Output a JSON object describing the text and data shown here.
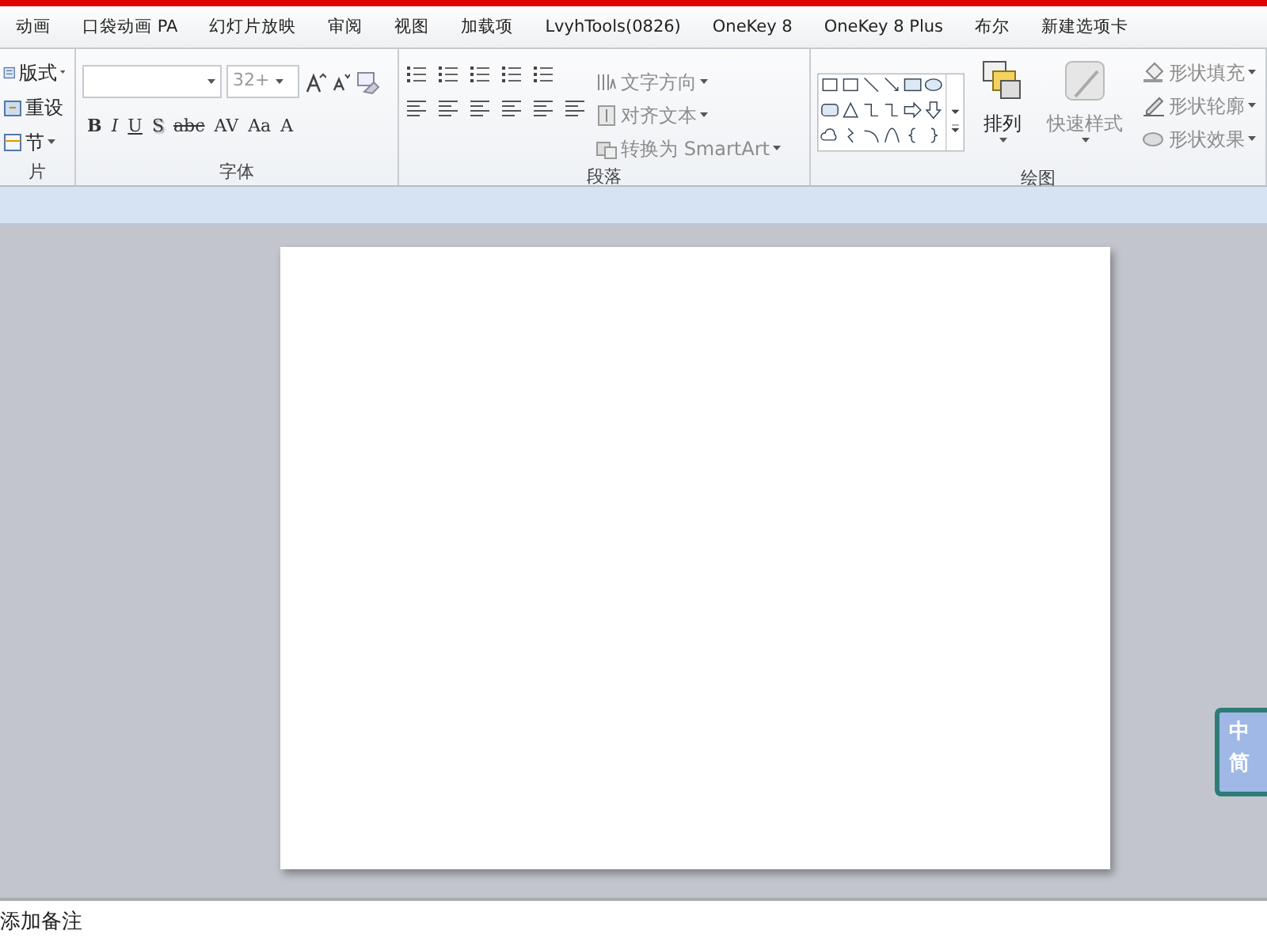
{
  "tabs": [
    {
      "label": "动画",
      "selected": false
    },
    {
      "label": "口袋动画 PA",
      "selected": false
    },
    {
      "label": "幻灯片放映",
      "selected": false
    },
    {
      "label": "审阅",
      "selected": false
    },
    {
      "label": "视图",
      "selected": false
    },
    {
      "label": "加载项",
      "selected": false
    },
    {
      "label": "LvyhTools(0826)",
      "selected": false
    },
    {
      "label": "OneKey 8",
      "selected": false
    },
    {
      "label": "OneKey 8 Plus",
      "selected": false
    },
    {
      "label": "布尔",
      "selected": false
    },
    {
      "label": "新建选项卡",
      "selected": false
    }
  ],
  "slides_group": {
    "label": "片",
    "buttons": [
      {
        "label": "版式",
        "dropdown": true
      },
      {
        "label": "重设",
        "dropdown": false
      },
      {
        "label": "节",
        "dropdown": true
      }
    ]
  },
  "font_group": {
    "label": "字体",
    "font_size": "32+",
    "format_buttons": [
      "B",
      "I",
      "U",
      "S",
      "abc",
      "AV",
      "Aa",
      "A"
    ]
  },
  "paragraph_group": {
    "label": "段落",
    "commands": [
      {
        "label": "文字方向",
        "disabled": true
      },
      {
        "label": "对齐文本",
        "disabled": true
      },
      {
        "label": "转换为 SmartArt",
        "disabled": true
      }
    ]
  },
  "drawing_group": {
    "label": "绘图",
    "large_buttons": [
      {
        "label": "排列",
        "disabled": false
      },
      {
        "label": "快速样式",
        "disabled": true
      }
    ],
    "commands": [
      {
        "label": "形状填充",
        "disabled": true
      },
      {
        "label": "形状轮廓",
        "disabled": true
      },
      {
        "label": "形状效果",
        "disabled": true
      }
    ]
  },
  "notes": {
    "text": "添加备注"
  },
  "ime_badge": {
    "lines": [
      "中",
      "简"
    ]
  }
}
